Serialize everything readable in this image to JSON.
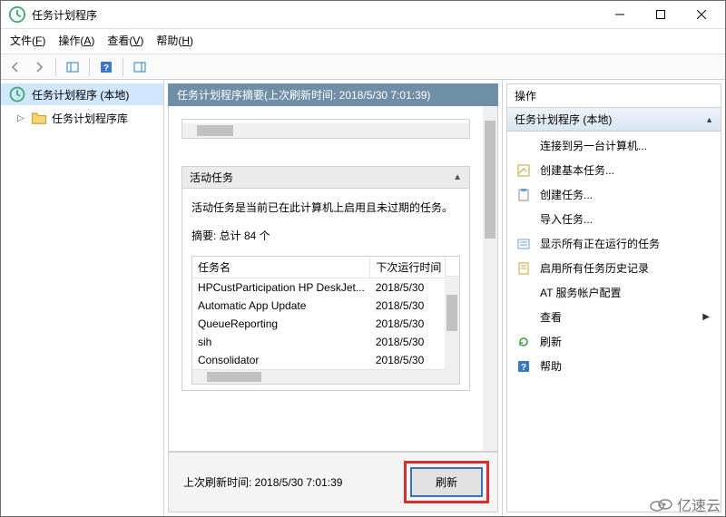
{
  "window": {
    "title": "任务计划程序"
  },
  "menu": {
    "file": "文件(F)",
    "action": "操作(A)",
    "view": "查看(V)",
    "help": "帮助(H)"
  },
  "tree": {
    "root": "任务计划程序 (本地)",
    "lib": "任务计划程序库"
  },
  "center": {
    "header": "任务计划程序摘要(上次刷新时间: 2018/5/30 7:01:39)",
    "active_header": "活动任务",
    "desc": "活动任务是当前已在此计算机上启用且未过期的任务。",
    "summary": "摘要: 总计 84 个",
    "col_name": "任务名",
    "col_next": "下次运行时间",
    "tasks": [
      {
        "name": "HPCustParticipation HP DeskJet...",
        "next": "2018/5/30"
      },
      {
        "name": "Automatic App Update",
        "next": "2018/5/30"
      },
      {
        "name": "QueueReporting",
        "next": "2018/5/30"
      },
      {
        "name": "sih",
        "next": "2018/5/30"
      },
      {
        "name": "Consolidator",
        "next": "2018/5/30"
      }
    ],
    "last_refresh": "上次刷新时间: 2018/5/30 7:01:39",
    "refresh_btn": "刷新"
  },
  "actions": {
    "header": "操作",
    "sub": "任务计划程序 (本地)",
    "items": [
      {
        "label": "连接到另一台计算机...",
        "icon": "none"
      },
      {
        "label": "创建基本任务...",
        "icon": "wizard"
      },
      {
        "label": "创建任务...",
        "icon": "task"
      },
      {
        "label": "导入任务...",
        "icon": "none"
      },
      {
        "label": "显示所有正在运行的任务",
        "icon": "list"
      },
      {
        "label": "启用所有任务历史记录",
        "icon": "history"
      },
      {
        "label": "AT 服务帐户配置",
        "icon": "none"
      },
      {
        "label": "查看",
        "icon": "none",
        "arrow": true
      },
      {
        "label": "刷新",
        "icon": "refresh"
      },
      {
        "label": "帮助",
        "icon": "help"
      }
    ]
  },
  "watermark": "亿速云"
}
